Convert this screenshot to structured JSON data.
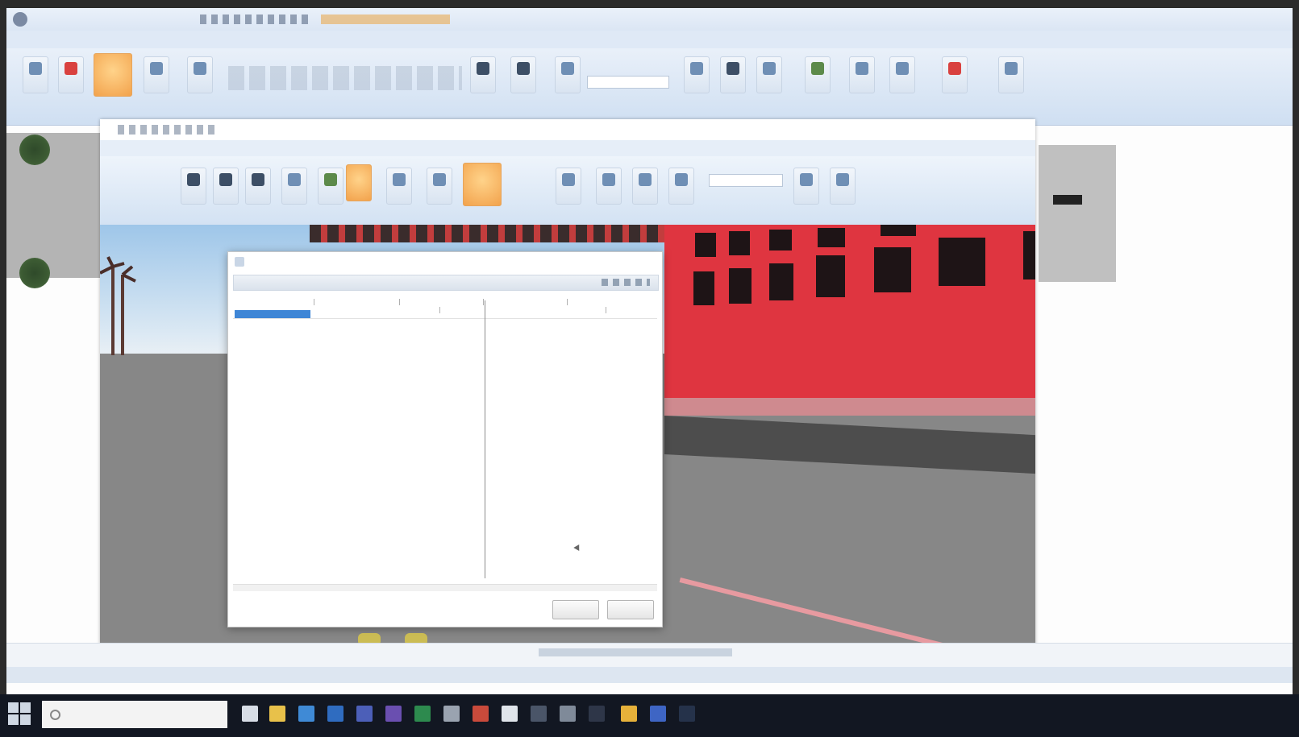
{
  "app": {
    "title": "",
    "tabs": [
      "",
      "",
      "",
      "",
      "",
      "",
      "",
      "",
      ""
    ]
  },
  "inner_window": {
    "title": "",
    "tabs": [
      "",
      ""
    ]
  },
  "dialog": {
    "title": "",
    "toolbar_label": "",
    "ok_label": "",
    "cancel_label": ""
  },
  "taskbar": {
    "search_placeholder": "",
    "tray_text": ""
  },
  "colors": {
    "accent_blue": "#3f86d6",
    "ribbon_orange": "#f2a24c",
    "scene_red_wall": "#df3540",
    "taskbar_bg": "#121722"
  }
}
